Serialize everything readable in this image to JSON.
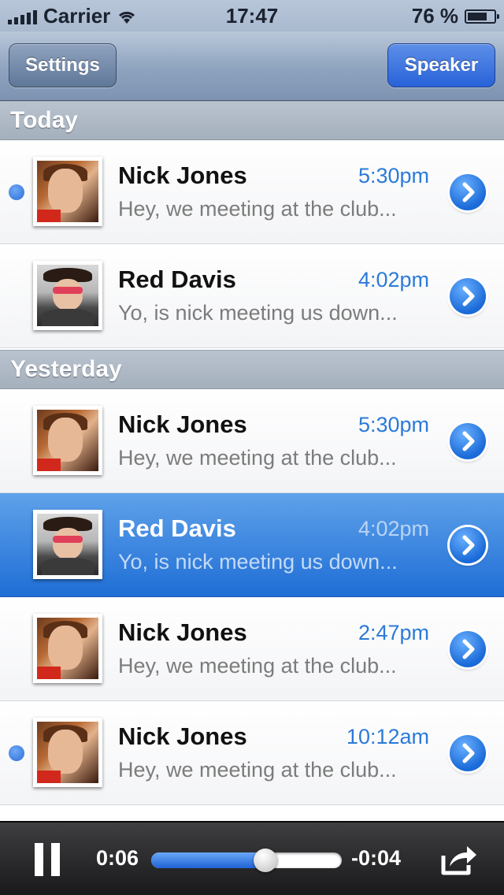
{
  "status_bar": {
    "carrier": "Carrier",
    "time": "17:47",
    "battery": "76 %",
    "battery_level": 0.76
  },
  "nav": {
    "left_button": "Settings",
    "right_button": "Speaker"
  },
  "sections": [
    {
      "title": "Today"
    },
    {
      "title": "Yesterday"
    }
  ],
  "messages": [
    {
      "name": "Nick Jones",
      "time": "5:30pm",
      "preview": "Hey, we meeting at the club...",
      "unread": true
    },
    {
      "name": "Red Davis",
      "time": "4:02pm",
      "preview": "Yo, is nick meeting us down...",
      "unread": false
    },
    {
      "name": "Nick Jones",
      "time": "5:30pm",
      "preview": "Hey, we meeting at the club...",
      "unread": false
    },
    {
      "name": "Red Davis",
      "time": "4:02pm",
      "preview": "Yo, is nick meeting us down...",
      "unread": false,
      "selected": true
    },
    {
      "name": "Nick Jones",
      "time": "2:47pm",
      "preview": "Hey, we meeting at the club...",
      "unread": false
    },
    {
      "name": "Nick Jones",
      "time": "10:12am",
      "preview": "Hey, we meeting at the club...",
      "unread": true
    }
  ],
  "player": {
    "elapsed": "0:06",
    "remaining": "-0:04",
    "progress": 0.6
  },
  "colors": {
    "accent": "#2b7ad8",
    "selected_row": "#1f6ed6",
    "unread_dot": "#2c6fd8"
  }
}
